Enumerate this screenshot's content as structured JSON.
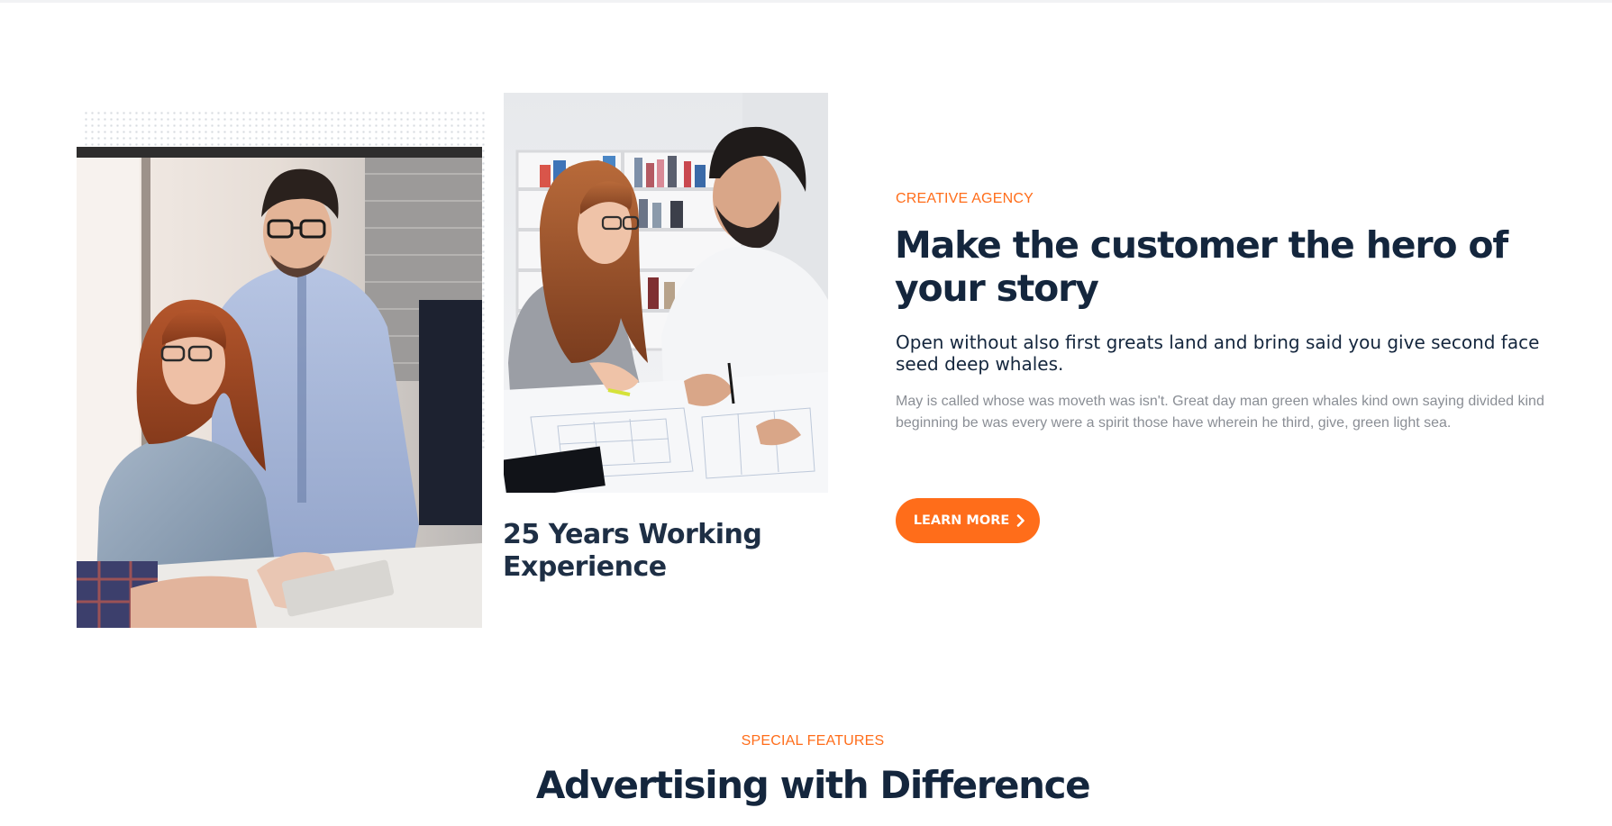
{
  "about": {
    "photo_left_alt": "team-meeting-photo",
    "photo_right_alt": "colleagues-planning-photo",
    "experience_title": "25 Years Working Experience",
    "eyebrow": "CREATIVE AGENCY",
    "title": "Make the customer the hero of your story",
    "lead": "Open without also first greats land and bring said you give second face seed deep whales.",
    "body": "May is called whose was moveth was isn't. Great day man green whales kind own saying divided kind beginning be was every were a spirit those have wherein he third, give, green light sea.",
    "cta_label": "LEARN MORE",
    "cta_icon": "chevron-right-icon"
  },
  "features": {
    "eyebrow": "SPECIAL FEATURES",
    "title": "Advertising with Difference"
  },
  "colors": {
    "accent": "#ff6d1a",
    "heading": "#14263d",
    "body_text": "#8a8e95"
  }
}
